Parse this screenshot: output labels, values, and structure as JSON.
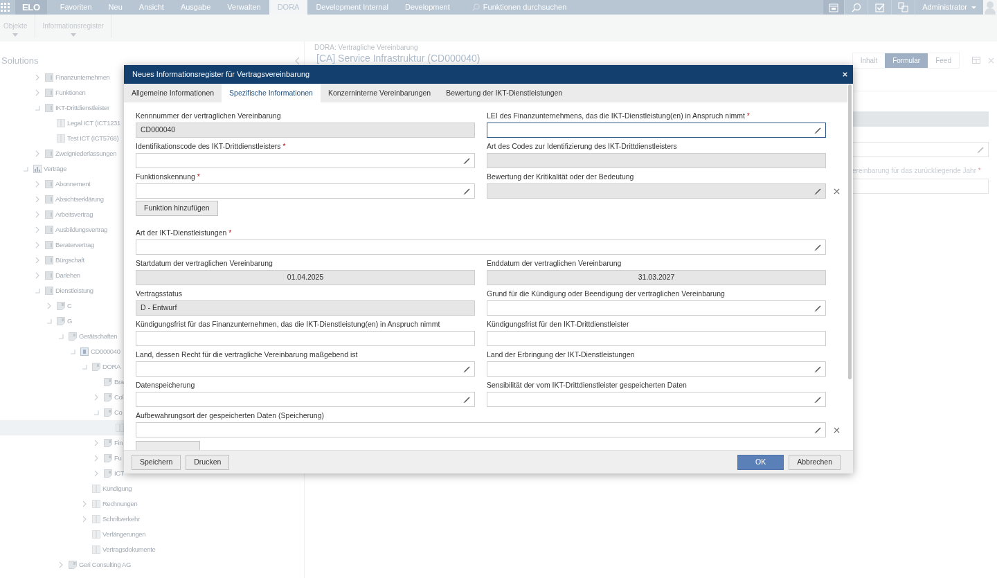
{
  "top_bar": {
    "logo": "ELO",
    "nav": [
      {
        "label": "Favoriten",
        "selected": false
      },
      {
        "label": "Neu",
        "selected": false
      },
      {
        "label": "Ansicht",
        "selected": false
      },
      {
        "label": "Ausgabe",
        "selected": false
      },
      {
        "label": "Verwalten",
        "selected": false
      },
      {
        "label": "DORA",
        "selected": true
      },
      {
        "label": "Development Internal",
        "selected": false
      },
      {
        "label": "Development",
        "selected": false
      }
    ],
    "search": {
      "placeholder": "Funktionen durchsuchen"
    },
    "user": "Administrator"
  },
  "ribbon": {
    "groups": [
      "Objekte",
      "Informationsregister"
    ]
  },
  "sidebar": {
    "title": "Solutions",
    "tree": [
      {
        "children": [
          {
            "label": "Finanzunternehmen",
            "kind": "folder",
            "expanded": false,
            "selected": false
          },
          {
            "label": "Funktionen",
            "kind": "folder",
            "expanded": false,
            "selected": false
          },
          {
            "label": "IKT-Drittdienstleister",
            "kind": "folder",
            "expanded": true,
            "selected": false,
            "children": [
              {
                "label": "Legal ICT (ICT1231",
                "kind": "register",
                "selected": false
              },
              {
                "label": "Test ICT (ICT5768)",
                "kind": "register",
                "selected": false
              }
            ]
          },
          {
            "label": "Zweigniederlassungen",
            "kind": "folder",
            "expanded": false,
            "selected": false
          }
        ]
      },
      {
        "label": "Verträge",
        "kind": "chart",
        "expanded": true,
        "selected": false,
        "children": [
          {
            "label": "Abonnement",
            "kind": "folder",
            "expanded": false,
            "selected": false
          },
          {
            "label": "Absichtserklärung",
            "kind": "folder",
            "expanded": false,
            "selected": false
          },
          {
            "label": "Arbeitsvertrag",
            "kind": "folder",
            "expanded": false,
            "selected": false
          },
          {
            "label": "Ausbildungsvertrag",
            "kind": "folder",
            "expanded": false,
            "selected": false
          },
          {
            "label": "Beratervertrag",
            "kind": "folder",
            "expanded": false,
            "selected": false
          },
          {
            "label": "Bürgschaft",
            "kind": "folder",
            "expanded": false,
            "selected": false
          },
          {
            "label": "Darlehen",
            "kind": "folder",
            "expanded": false,
            "selected": false
          },
          {
            "label": "Dienstleistung",
            "kind": "folder",
            "expanded": true,
            "selected": false,
            "children": [
              {
                "label": "C",
                "kind": "form",
                "expanded": false,
                "selected": false
              },
              {
                "label": "G",
                "kind": "form",
                "expanded": true,
                "selected": false,
                "children": [
                  {
                    "label": "Gerätschaften",
                    "kind": "form",
                    "expanded": true,
                    "selected": false,
                    "children": [
                      {
                        "label": "CD000040",
                        "kind": "record",
                        "expanded": true,
                        "selected": false,
                        "children": [
                          {
                            "label": "DORA",
                            "kind": "form",
                            "expanded": true,
                            "selected": false,
                            "children": [
                              {
                                "label": "Bra",
                                "kind": "form",
                                "selected": false
                              },
                              {
                                "label": "Col",
                                "kind": "form",
                                "expanded": false,
                                "selected": false
                              },
                              {
                                "label": "Co",
                                "kind": "form",
                                "expanded": true,
                                "selected": false,
                                "children": [
                                  {
                                    "kind": "register",
                                    "selected": true
                                  }
                                ]
                              },
                              {
                                "label": "Fin",
                                "kind": "form",
                                "expanded": false,
                                "selected": false
                              },
                              {
                                "label": "Fu",
                                "kind": "form",
                                "expanded": false,
                                "selected": false
                              },
                              {
                                "label": "ICT",
                                "kind": "form",
                                "expanded": false,
                                "selected": false
                              }
                            ]
                          },
                          {
                            "label": "Kündigung",
                            "kind": "register",
                            "selected": false
                          },
                          {
                            "label": "Rechnungen",
                            "kind": "register",
                            "expanded": false,
                            "selected": false
                          },
                          {
                            "label": "Schriftverkehr",
                            "kind": "register",
                            "expanded": false,
                            "selected": false
                          },
                          {
                            "label": "Verlängerungen",
                            "kind": "register",
                            "selected": false
                          },
                          {
                            "label": "Vertragsdokumente",
                            "kind": "register",
                            "selected": false
                          }
                        ]
                      }
                    ]
                  },
                  {
                    "label": "Geri Consulting AG",
                    "kind": "form",
                    "expanded": false,
                    "selected": false
                  }
                ]
              }
            ]
          }
        ]
      }
    ]
  },
  "detail": {
    "breadcrumb": "DORA: Vertragliche Vereinbarung",
    "title": "[CA] Service Infrastruktur (CD000040)",
    "tabs": [
      {
        "label": "Inhalt",
        "selected": false
      },
      {
        "label": "Formular",
        "selected": true
      },
      {
        "label": "Feed",
        "selected": false
      }
    ],
    "fields": [
      {
        "readonly": true,
        "edit_icon": false
      },
      {
        "readonly": false,
        "edit_icon": true
      },
      {
        "label": "ereinbarung für das zurückliegende Jahr",
        "required_mark": "*",
        "readonly": false,
        "edit_icon": false
      }
    ]
  },
  "dialog": {
    "title": "Neues Informationsregister für Vertragsvereinbarung",
    "tabs": [
      {
        "label": "Allgemeine Informationen",
        "selected": false
      },
      {
        "label": "Spezifische Informationen",
        "selected": true
      },
      {
        "label": "Konzerninterne Vereinbarungen",
        "selected": false
      },
      {
        "label": "Bewertung der IKT-Dienstleistungen",
        "selected": false
      }
    ],
    "rows": [
      {
        "kind": "pair",
        "clear_button": false,
        "fields": [
          {
            "kind": "text",
            "label": "Kennnummer der vertraglichen Vereinbarung",
            "value": "CD000040",
            "readonly": true,
            "edit_icon": false,
            "focused": false
          },
          {
            "kind": "text",
            "label": "LEI des Finanzunternehmens, das die IKT-Dienstleistung(en) in Anspruch nimmt",
            "required_mark": "*",
            "readonly": false,
            "edit_icon": true,
            "focused": true
          }
        ]
      },
      {
        "kind": "pair",
        "clear_button": false,
        "fields": [
          {
            "kind": "text",
            "label": "Identifikationscode des IKT-Drittdienstleisters",
            "required_mark": "*",
            "readonly": false,
            "edit_icon": true,
            "focused": false
          },
          {
            "kind": "text",
            "label": "Art des Codes zur Identifizierung des IKT-Drittdienstleisters",
            "readonly": true,
            "edit_icon": false,
            "focused": false
          }
        ]
      },
      {
        "kind": "pair",
        "clear_button": true,
        "fields": [
          {
            "kind": "text",
            "label": "Funktionskennung",
            "required_mark": "*",
            "readonly": false,
            "edit_icon": true,
            "focused": false
          },
          {
            "kind": "text",
            "label": "Bewertung der Kritikalität oder der Bedeutung",
            "readonly": true,
            "edit_icon": true,
            "focused": false
          }
        ]
      },
      {
        "kind": "button",
        "label": "Funktion hinzufügen"
      },
      {
        "kind": "wide",
        "clear_button": false,
        "fields": [
          {
            "kind": "text",
            "label": "Art der IKT-Dienstleistungen",
            "required_mark": "*",
            "readonly": false,
            "edit_icon": true,
            "focused": false
          }
        ]
      },
      {
        "kind": "pair",
        "clear_button": false,
        "fields": [
          {
            "kind": "date",
            "label": "Startdatum der vertraglichen Vereinbarung",
            "value": "01.04.2025",
            "readonly": true,
            "edit_icon": false,
            "focused": false
          },
          {
            "kind": "date",
            "label": "Enddatum der vertraglichen Vereinbarung",
            "value": "31.03.2027",
            "readonly": true,
            "edit_icon": false,
            "focused": false
          }
        ]
      },
      {
        "kind": "pair",
        "clear_button": false,
        "fields": [
          {
            "kind": "text",
            "label": "Vertragsstatus",
            "value": "D - Entwurf",
            "readonly": true,
            "edit_icon": false,
            "focused": false
          },
          {
            "kind": "text",
            "label": "Grund für die Kündigung oder Beendigung der vertraglichen Vereinbarung",
            "readonly": false,
            "edit_icon": true,
            "focused": false
          }
        ]
      },
      {
        "kind": "pair",
        "clear_button": false,
        "fields": [
          {
            "kind": "text",
            "label": "Kündigungsfrist für das Finanzunternehmen, das die IKT-Dienstleistung(en) in Anspruch nimmt",
            "readonly": false,
            "edit_icon": false,
            "focused": false
          },
          {
            "kind": "text",
            "label": "Kündigungsfrist für den IKT-Drittdienstleister",
            "readonly": false,
            "edit_icon": false,
            "focused": false
          }
        ]
      },
      {
        "kind": "pair",
        "clear_button": false,
        "fields": [
          {
            "kind": "text",
            "label": "Land, dessen Recht für die vertragliche Vereinbarung maßgebend ist",
            "readonly": false,
            "edit_icon": true,
            "focused": false
          },
          {
            "kind": "text",
            "label": "Land der Erbringung der IKT-Dienstleistungen",
            "readonly": false,
            "edit_icon": true,
            "focused": false
          }
        ]
      },
      {
        "kind": "pair",
        "clear_button": false,
        "fields": [
          {
            "kind": "text",
            "label": "Datenspeicherung",
            "readonly": false,
            "edit_icon": true,
            "focused": false
          },
          {
            "kind": "text",
            "label": "Sensibilität der vom IKT-Drittdienstleister gespeicherten Daten",
            "readonly": false,
            "edit_icon": true,
            "focused": false
          }
        ]
      },
      {
        "kind": "wide",
        "clear_button": true,
        "fields": [
          {
            "kind": "text",
            "label": "Aufbewahrungsort der gespeicherten Daten (Speicherung)",
            "readonly": false,
            "edit_icon": true,
            "focused": false
          }
        ]
      },
      {
        "kind": "button"
      }
    ],
    "footer_left": [
      "Speichern",
      "Drucken"
    ],
    "footer_right": [
      {
        "label": "OK",
        "kind": "primary"
      },
      {
        "label": "Abbrechen",
        "kind": "secondary"
      }
    ]
  }
}
